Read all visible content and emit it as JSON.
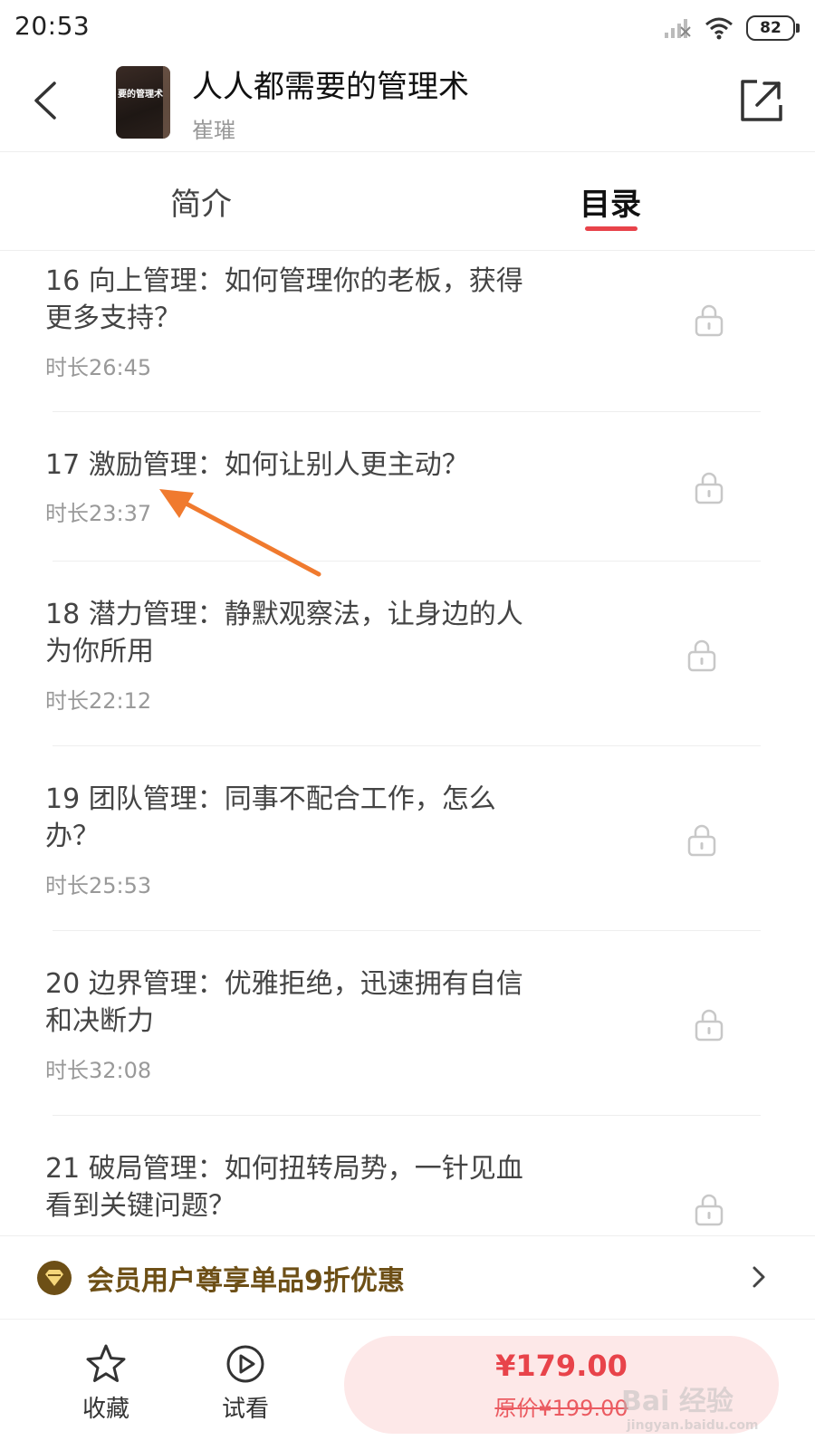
{
  "status_bar": {
    "time": "20:53",
    "battery": "82"
  },
  "header": {
    "title": "人人都需要的管理术",
    "author": "崔璀",
    "cover_text": "要的管理术"
  },
  "tabs": [
    {
      "label": "简介",
      "active": false
    },
    {
      "label": "目录",
      "active": true
    }
  ],
  "chapters": [
    {
      "title": "16 向上管理：如何管理你的老板，获得更多支持？",
      "duration": "时长26:45",
      "locked": true
    },
    {
      "title": "17 激励管理：如何让别人更主动？",
      "duration": "时长23:37",
      "locked": true
    },
    {
      "title": "18 潜力管理：静默观察法，让身边的人为你所用",
      "duration": "时长22:12",
      "locked": true
    },
    {
      "title": "19 团队管理：同事不配合工作，怎么办？",
      "duration": "时长25:53",
      "locked": true
    },
    {
      "title": "20 边界管理：优雅拒绝，迅速拥有自信和决断力",
      "duration": "时长32:08",
      "locked": true
    },
    {
      "title": "21 破局管理：如何扭转局势，一针见血看到关键问题？",
      "duration": "",
      "locked": true
    }
  ],
  "member_bar": {
    "text": "会员用户尊享单品9折优惠"
  },
  "bottom_bar": {
    "favorite_label": "收藏",
    "preview_label": "试看",
    "price": "¥179.00",
    "original_price": "原价¥199.00"
  },
  "watermark": {
    "main": "Bai 经验",
    "sub": "jingyan.baidu.com"
  },
  "colors": {
    "accent": "#e8434a",
    "member_gold": "#6d4f16",
    "annotation_arrow": "#f07a2e"
  },
  "icons": [
    "back-arrow-icon",
    "share-icon",
    "lock-icon",
    "member-badge-icon",
    "chevron-right-icon",
    "star-icon",
    "play-circle-icon"
  ]
}
